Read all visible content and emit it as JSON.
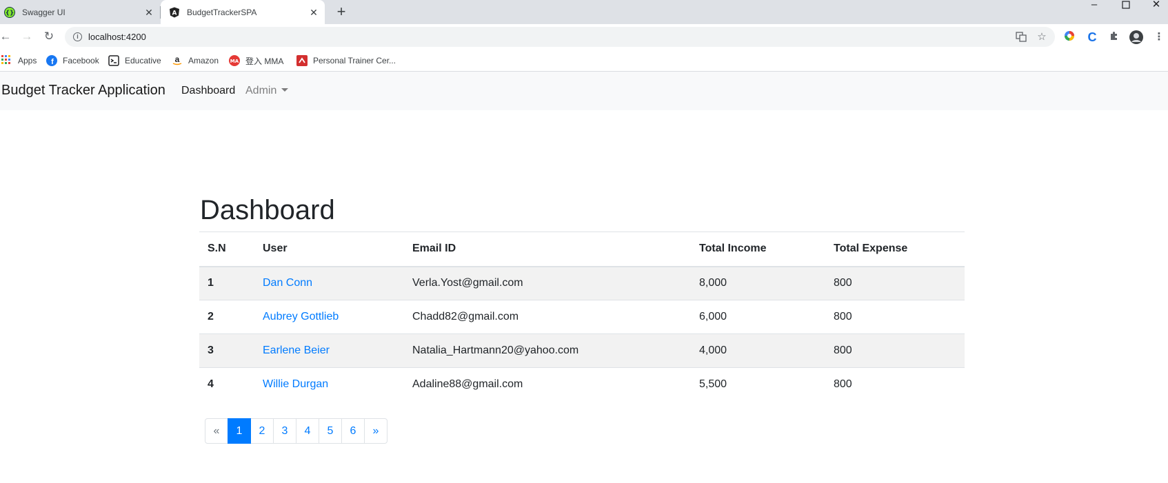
{
  "browser": {
    "tabs": [
      {
        "title": "Swagger UI",
        "active": false
      },
      {
        "title": "BudgetTrackerSPA",
        "active": true
      }
    ],
    "url": "localhost:4200",
    "bookmarks": [
      {
        "label": "Apps",
        "icon": "apps-grid-icon"
      },
      {
        "label": "Facebook",
        "icon": "facebook-icon"
      },
      {
        "label": "Educative",
        "icon": "educative-icon"
      },
      {
        "label": "Amazon",
        "icon": "amazon-icon"
      },
      {
        "label": "登入 MMA",
        "icon": "mma-icon"
      },
      {
        "label": "Personal Trainer Cer...",
        "icon": "trainer-icon"
      }
    ]
  },
  "navbar": {
    "brand": "Budget Tracker Application",
    "links": [
      {
        "label": "Dashboard"
      },
      {
        "label": "Admin",
        "dropdown": true
      }
    ]
  },
  "dashboard": {
    "title": "Dashboard",
    "columns": [
      "S.N",
      "User",
      "Email ID",
      "Total Income",
      "Total Expense"
    ],
    "rows": [
      {
        "sn": "1",
        "user": "Dan Conn",
        "email": "Verla.Yost@gmail.com",
        "income": "8,000",
        "expense": "800"
      },
      {
        "sn": "2",
        "user": "Aubrey Gottlieb",
        "email": "Chadd82@gmail.com",
        "income": "6,000",
        "expense": "800"
      },
      {
        "sn": "3",
        "user": "Earlene Beier",
        "email": "Natalia_Hartmann20@yahoo.com",
        "income": "4,000",
        "expense": "800"
      },
      {
        "sn": "4",
        "user": "Willie Durgan",
        "email": "Adaline88@gmail.com",
        "income": "5,500",
        "expense": "800"
      }
    ],
    "pagination": {
      "prev": "«",
      "pages": [
        "1",
        "2",
        "3",
        "4",
        "5",
        "6"
      ],
      "next": "»",
      "active_page": "1"
    }
  },
  "colors": {
    "link": "#007bff",
    "navbar_bg": "#f8f9fa",
    "stripe": "#f2f2f2"
  }
}
